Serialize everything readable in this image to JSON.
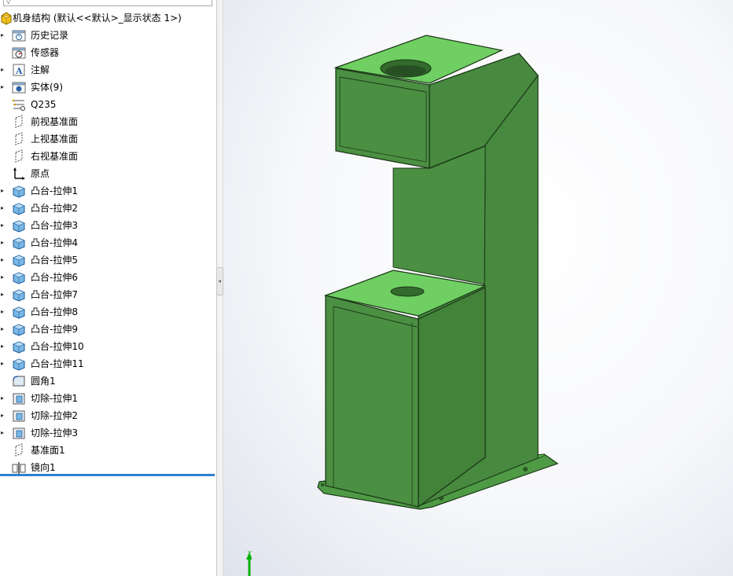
{
  "tree": {
    "root": {
      "label": "机身结构  (默认<<默认>_显示状态 1>)",
      "icon": "part-icon"
    },
    "items": [
      {
        "label": "历史记录",
        "icon": "history-icon",
        "expandable": true
      },
      {
        "label": "传感器",
        "icon": "sensor-icon",
        "expandable": false
      },
      {
        "label": "注解",
        "icon": "annotation-icon",
        "expandable": true
      },
      {
        "label": "实体(9)",
        "icon": "solid-bodies-icon",
        "expandable": true
      },
      {
        "label": "Q235",
        "icon": "material-icon",
        "expandable": false
      },
      {
        "label": "前视基准面",
        "icon": "plane-icon",
        "expandable": false
      },
      {
        "label": "上视基准面",
        "icon": "plane-icon",
        "expandable": false
      },
      {
        "label": "右视基准面",
        "icon": "plane-icon",
        "expandable": false
      },
      {
        "label": "原点",
        "icon": "origin-icon",
        "expandable": false
      },
      {
        "label": "凸台-拉伸1",
        "icon": "boss-extrude-icon",
        "expandable": true
      },
      {
        "label": "凸台-拉伸2",
        "icon": "boss-extrude-icon",
        "expandable": true
      },
      {
        "label": "凸台-拉伸3",
        "icon": "boss-extrude-icon",
        "expandable": true
      },
      {
        "label": "凸台-拉伸4",
        "icon": "boss-extrude-icon",
        "expandable": true
      },
      {
        "label": "凸台-拉伸5",
        "icon": "boss-extrude-icon",
        "expandable": true
      },
      {
        "label": "凸台-拉伸6",
        "icon": "boss-extrude-icon",
        "expandable": true
      },
      {
        "label": "凸台-拉伸7",
        "icon": "boss-extrude-icon",
        "expandable": true
      },
      {
        "label": "凸台-拉伸8",
        "icon": "boss-extrude-icon",
        "expandable": true
      },
      {
        "label": "凸台-拉伸9",
        "icon": "boss-extrude-icon",
        "expandable": true
      },
      {
        "label": "凸台-拉伸10",
        "icon": "boss-extrude-icon",
        "expandable": true
      },
      {
        "label": "凸台-拉伸11",
        "icon": "boss-extrude-icon",
        "expandable": true
      },
      {
        "label": "圆角1",
        "icon": "fillet-icon",
        "expandable": false
      },
      {
        "label": "切除-拉伸1",
        "icon": "cut-extrude-icon",
        "expandable": true
      },
      {
        "label": "切除-拉伸2",
        "icon": "cut-extrude-icon",
        "expandable": true
      },
      {
        "label": "切除-拉伸3",
        "icon": "cut-extrude-icon",
        "expandable": true
      },
      {
        "label": "基准面1",
        "icon": "plane-icon",
        "expandable": false
      },
      {
        "label": "镜向1",
        "icon": "mirror-icon",
        "expandable": false
      }
    ]
  },
  "colors": {
    "model_green": "#4a8c42",
    "model_top": "#6fcf63",
    "model_edge": "#1c3a18",
    "rollback_bar": "#2f7fcf",
    "triad_y": "#00b000"
  },
  "viewport": {
    "triad_axis": "Y"
  }
}
